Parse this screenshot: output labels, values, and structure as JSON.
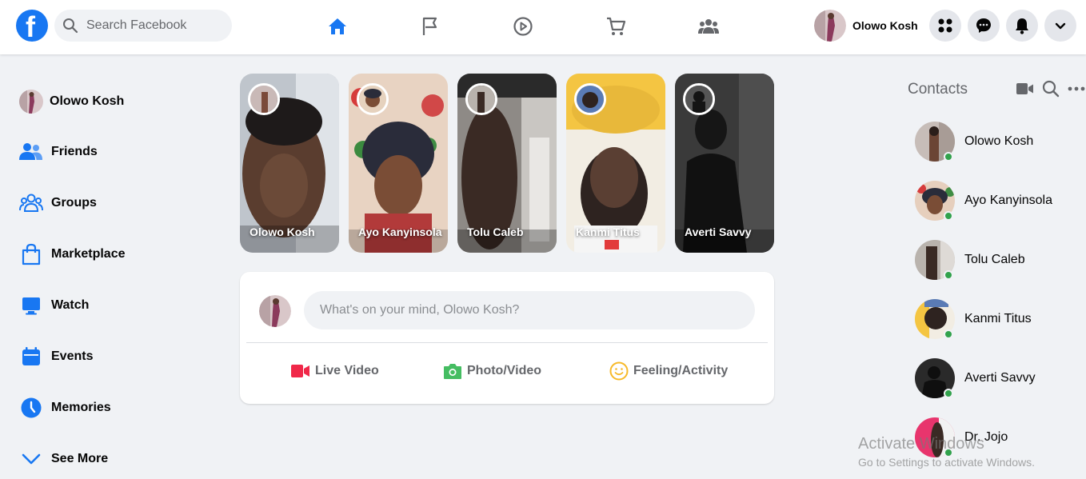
{
  "header": {
    "logo_letter": "f",
    "search_placeholder": "Search Facebook",
    "nav": [
      "home-icon",
      "pages-flag-icon",
      "watch-play-icon",
      "marketplace-cart-icon",
      "groups-icon"
    ],
    "active_nav": "home-icon",
    "profile_name": "Olowo Kosh",
    "buttons": [
      "menu-grid-icon",
      "messenger-icon",
      "notifications-bell-icon",
      "account-chevron-down-icon"
    ],
    "accent_color": "#1877f2"
  },
  "sidebar": {
    "items": [
      {
        "label": "Olowo Kosh",
        "icon": "avatar"
      },
      {
        "label": "Friends",
        "icon": "friends-icon"
      },
      {
        "label": "Groups",
        "icon": "groups-icon"
      },
      {
        "label": "Marketplace",
        "icon": "marketplace-bag-icon"
      },
      {
        "label": "Watch",
        "icon": "watch-monitor-icon"
      },
      {
        "label": "Events",
        "icon": "calendar-icon"
      },
      {
        "label": "Memories",
        "icon": "clock-icon"
      },
      {
        "label": "See More",
        "icon": "chevron-down-icon"
      }
    ]
  },
  "stories": [
    {
      "name": "Olowo Kosh"
    },
    {
      "name": "Ayo Kanyinsola"
    },
    {
      "name": "Tolu Caleb"
    },
    {
      "name": "Kanmi Titus"
    },
    {
      "name": "Averti Savvy"
    }
  ],
  "composer": {
    "placeholder": "What's on your mind, Olowo Kosh?",
    "actions": [
      {
        "label": "Live Video",
        "icon": "live-video-icon",
        "color": "#f02849"
      },
      {
        "label": "Photo/Video",
        "icon": "photo-video-icon",
        "color": "#45bd62"
      },
      {
        "label": "Feeling/Activity",
        "icon": "feeling-smiley-icon",
        "color": "#f7b928"
      }
    ]
  },
  "contacts": {
    "title": "Contacts",
    "icons": [
      "video-camera-icon",
      "search-icon",
      "more-dots-icon"
    ],
    "people": [
      {
        "name": "Olowo Kosh",
        "online": true
      },
      {
        "name": "Ayo Kanyinsola",
        "online": true
      },
      {
        "name": "Tolu Caleb",
        "online": true
      },
      {
        "name": "Kanmi Titus",
        "online": true
      },
      {
        "name": "Averti Savvy",
        "online": true
      },
      {
        "name": "Dr. Jojo",
        "online": true
      }
    ],
    "online_color": "#31a24c"
  },
  "watermark": {
    "line1": "Activate Windows",
    "line2": "Go to Settings to activate Windows."
  }
}
